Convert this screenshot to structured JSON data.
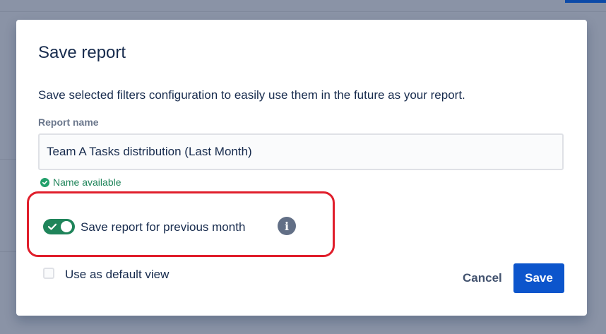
{
  "dialog": {
    "title": "Save report",
    "description": "Save selected filters configuration to easily use them in the future as your report.",
    "report_name": {
      "label": "Report name",
      "value": "Team A Tasks distribution (Last Month)",
      "validation_message": "Name available"
    },
    "previous_month_toggle": {
      "label": "Save report for previous month",
      "checked": true
    },
    "default_view_checkbox": {
      "label": "Use as default view",
      "checked": false
    },
    "buttons": {
      "cancel": "Cancel",
      "save": "Save"
    }
  },
  "colors": {
    "primary": "#0c55cc",
    "success": "#1f845a",
    "highlight": "#e01e2b",
    "text": "#172b4d"
  }
}
